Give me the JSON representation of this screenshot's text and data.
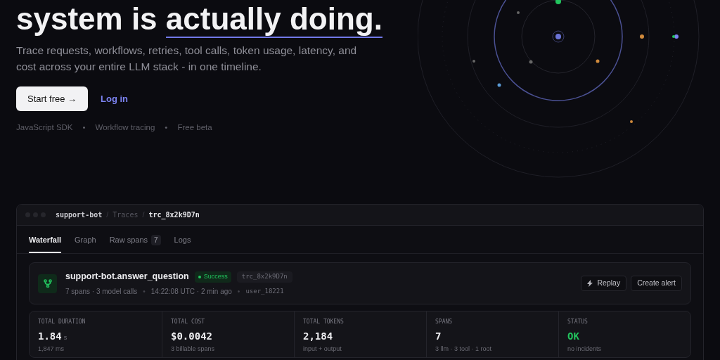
{
  "hero": {
    "headline_start": "system is ",
    "headline_highlight": "actually doing.",
    "subtitle": "Trace requests, workflows, retries, tool calls, token usage, latency, and cost across your entire LLM stack - in one timeline.",
    "primary_button": "Start free →",
    "secondary_link": "Log in",
    "features": [
      "JavaScript SDK",
      "Workflow tracing",
      "Free beta"
    ],
    "separator": "•"
  },
  "app": {
    "breadcrumb": [
      {
        "label": "support-bot",
        "kind": "project"
      },
      {
        "label": "Traces",
        "kind": "section"
      },
      {
        "label": "trc_8x2k9D7n",
        "kind": "current"
      }
    ],
    "breadcrumb_separator": "/",
    "tabs": [
      {
        "label": "Waterfall",
        "selected": true
      },
      {
        "label": "Graph",
        "selected": false
      },
      {
        "label": "Raw spans",
        "selected": false,
        "count": "7"
      },
      {
        "label": "Logs",
        "selected": false
      }
    ],
    "trace": {
      "name": "support-bot.answer_question",
      "status": "Success",
      "trace_id": "trc_8x2k9D7n",
      "details": [
        "7 spans · 3 model calls",
        "14:22:08 UTC · 2 min ago",
        "user_18221"
      ],
      "actions": [
        {
          "label": "Replay",
          "kind": "icon"
        },
        {
          "label": "Create alert",
          "kind": "plain"
        }
      ]
    },
    "stats": [
      {
        "label": "TOTAL DURATION",
        "value": "1.84",
        "unit": "s",
        "note": "1,847 ms",
        "kind": "normal"
      },
      {
        "label": "TOTAL COST",
        "value": "$0.0042",
        "note": "3 billable spans",
        "kind": "normal"
      },
      {
        "label": "TOTAL TOKENS",
        "value": "2,184",
        "note": "input + output",
        "kind": "normal"
      },
      {
        "label": "SPANS",
        "value": "7",
        "note": "3 llm · 3 tool · 1 root",
        "kind": "normal"
      },
      {
        "label": "STATUS",
        "value": "OK",
        "note": "no incidents",
        "kind": "good"
      }
    ]
  }
}
